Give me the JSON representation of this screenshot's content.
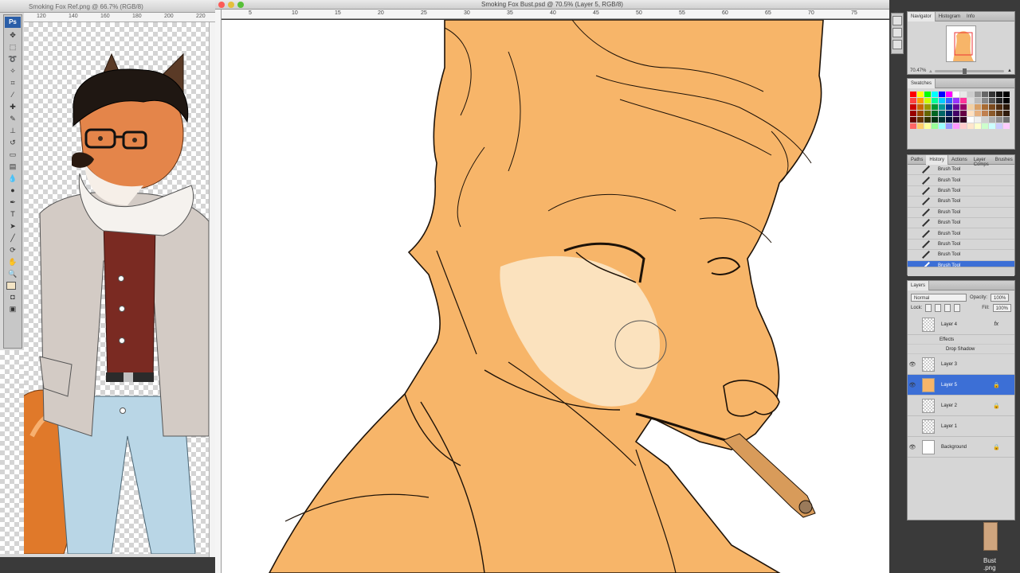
{
  "document": {
    "title": "Smoking Fox Bust.psd @ 70.5% (Layer 5, RGB/8)",
    "ruler_marks": [
      "5",
      "10",
      "15",
      "20",
      "25",
      "30",
      "35",
      "40",
      "45",
      "50",
      "55",
      "60",
      "65",
      "70",
      "75",
      "80"
    ]
  },
  "reference": {
    "title": "Smoking Fox Ref.png @ 66.7% (RGB/8)",
    "ruler_marks": [
      "120",
      "140",
      "160",
      "180",
      "200",
      "220"
    ]
  },
  "tools": {
    "badge": "Ps"
  },
  "navigator": {
    "tabs": [
      "Navigator",
      "Histogram",
      "Info"
    ],
    "zoom": "70.47%"
  },
  "swatches": {
    "tab": "Swatches",
    "colors": [
      "#ff0000",
      "#ffff00",
      "#00ff00",
      "#00ffff",
      "#0000ff",
      "#ff00ff",
      "#ffffff",
      "#e8e8e8",
      "#cccccc",
      "#999999",
      "#666666",
      "#333333",
      "#111111",
      "#000000",
      "#ff4040",
      "#ff9900",
      "#ccff00",
      "#00ff99",
      "#00ccff",
      "#3366ff",
      "#9933ff",
      "#ff3399",
      "#dddddd",
      "#bbbbbb",
      "#888888",
      "#555555",
      "#222222",
      "#000000",
      "#cc0000",
      "#cc6600",
      "#999900",
      "#009933",
      "#009999",
      "#003399",
      "#660099",
      "#990066",
      "#f2d0a4",
      "#d9a066",
      "#a86b32",
      "#7a4a1e",
      "#4d2c10",
      "#2a1808",
      "#990000",
      "#994400",
      "#666600",
      "#006622",
      "#006666",
      "#002266",
      "#440066",
      "#660044",
      "#ffe0c0",
      "#e6b080",
      "#c08050",
      "#8b5a2b",
      "#5c3a1a",
      "#301c0c",
      "#660000",
      "#663300",
      "#333300",
      "#003311",
      "#003333",
      "#001133",
      "#220033",
      "#330022",
      "#ffffff",
      "#f0f0f0",
      "#d0d0d0",
      "#b0b0b0",
      "#909090",
      "#707070",
      "#ff6666",
      "#ffcc66",
      "#ffff99",
      "#99ff99",
      "#99ffff",
      "#9999ff",
      "#ff99ff",
      "#ffcccc",
      "#ffe6cc",
      "#ffffcc",
      "#ccffcc",
      "#ccffff",
      "#ccccff",
      "#ffccff"
    ]
  },
  "history": {
    "tabs": [
      "Paths",
      "History",
      "Actions",
      "Layer Comps",
      "Brushes"
    ],
    "items": [
      "Brush Tool",
      "Brush Tool",
      "Brush Tool",
      "Brush Tool",
      "Brush Tool",
      "Brush Tool",
      "Brush Tool",
      "Brush Tool",
      "Brush Tool",
      "Brush Tool"
    ]
  },
  "layers": {
    "tab": "Layers",
    "blend_mode": "Normal",
    "opacity_label": "Opacity:",
    "opacity_value": "100%",
    "lock_label": "Lock:",
    "fill_label": "Fill:",
    "fill_value": "100%",
    "effects_label": "Effects",
    "drop_shadow_label": "Drop Shadow",
    "fx_badge": "fx",
    "items": [
      {
        "name": "Layer 4",
        "visible": false,
        "locked": false,
        "fx": true
      },
      {
        "name": "Layer 3",
        "visible": true,
        "locked": false,
        "fx": false
      },
      {
        "name": "Layer 5",
        "visible": true,
        "locked": true,
        "fx": false,
        "selected": true
      },
      {
        "name": "Layer 2",
        "visible": false,
        "locked": true,
        "fx": false
      },
      {
        "name": "Layer 1",
        "visible": false,
        "locked": false,
        "fx": false
      },
      {
        "name": "Background",
        "visible": true,
        "locked": true,
        "fx": false
      }
    ]
  },
  "dock": {
    "label": "Bust\n.png"
  }
}
